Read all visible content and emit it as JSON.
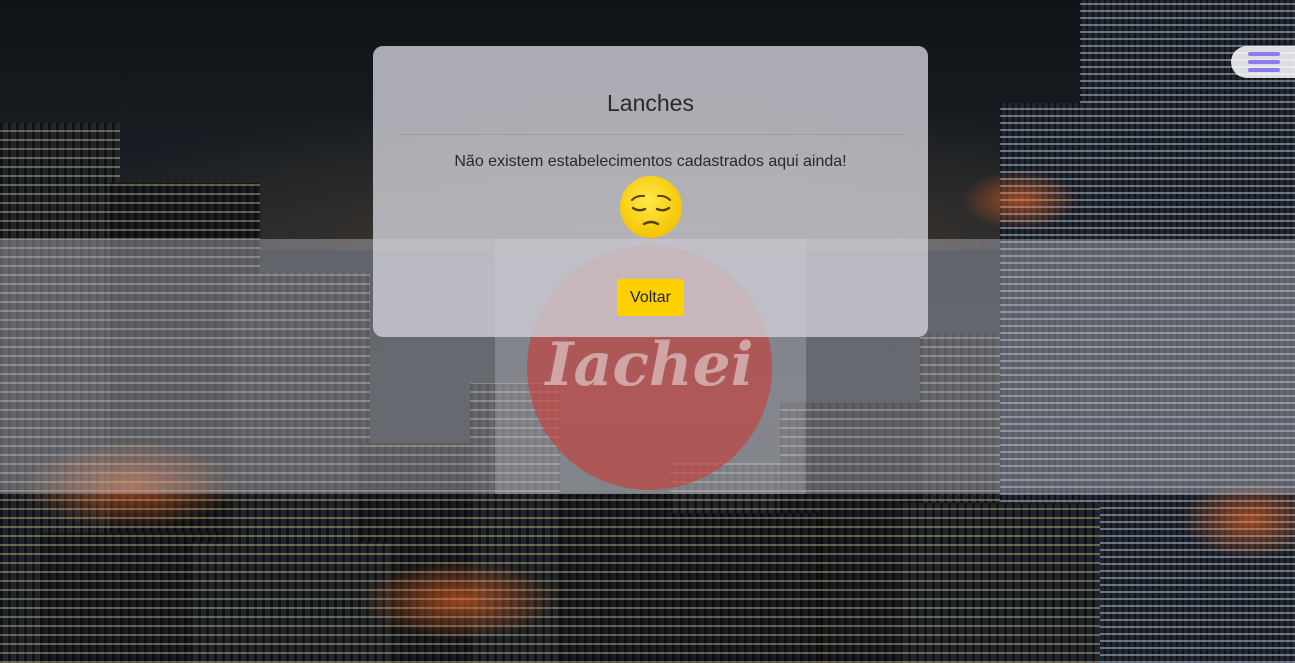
{
  "card": {
    "title": "Lanches",
    "message": "Não existem estabelecimentos cadastrados aqui ainda!",
    "emoji_icon": "pensive-face-icon",
    "back_button_label": "Voltar"
  },
  "logo": {
    "text": "Iachei"
  },
  "menu": {
    "icon": "hamburger-menu-icon"
  },
  "colors": {
    "button": "#ffd000",
    "menu_icon": "#8a7cf0",
    "logo": "#c83c37"
  }
}
